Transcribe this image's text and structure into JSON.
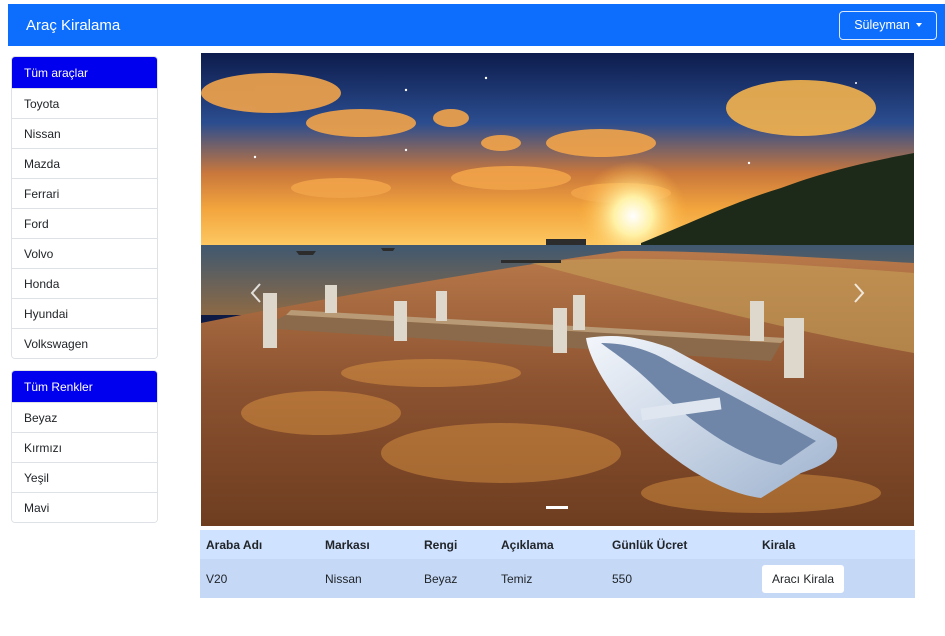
{
  "navbar": {
    "brand": "Araç Kiralama",
    "user": "Süleyman"
  },
  "brands": {
    "all_label": "Tüm araçlar",
    "items": [
      "Toyota",
      "Nissan",
      "Mazda",
      "Ferrari",
      "Ford",
      "Volvo",
      "Honda",
      "Hyundai",
      "Volkswagen"
    ]
  },
  "colors": {
    "all_label": "Tüm Renkler",
    "items": [
      "Beyaz",
      "Kırmızı",
      "Yeşil",
      "Mavi"
    ]
  },
  "carousel": {
    "slide_count": 1,
    "active_slide": 1
  },
  "table": {
    "headers": [
      "Araba Adı",
      "Markası",
      "Rengi",
      "Açıklama",
      "Günlük Ücret",
      "Kirala"
    ],
    "rows": [
      {
        "name": "V20",
        "brand": "Nissan",
        "color": "Beyaz",
        "description": "Temiz",
        "daily_price": "550",
        "action": "Aracı Kirala"
      }
    ]
  }
}
